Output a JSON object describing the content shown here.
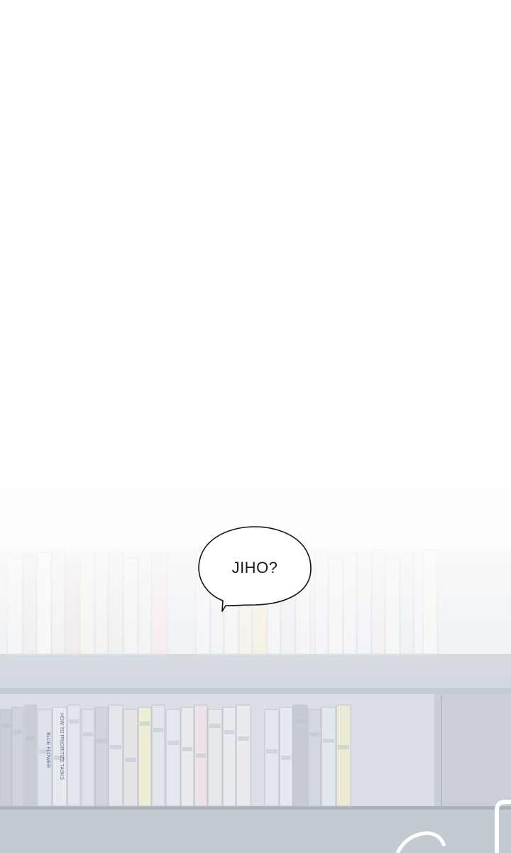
{
  "panel": {
    "dialogue": "JIHO?",
    "book_spine_texts": [
      "BLUE FLOWER",
      "HOW TO PRIORITIZE TASKS"
    ],
    "colors": {
      "background": "#ffffff",
      "shelf": "#c3cbd2",
      "bubble_fill": "#ffffff",
      "bubble_outline": "#111111"
    }
  }
}
